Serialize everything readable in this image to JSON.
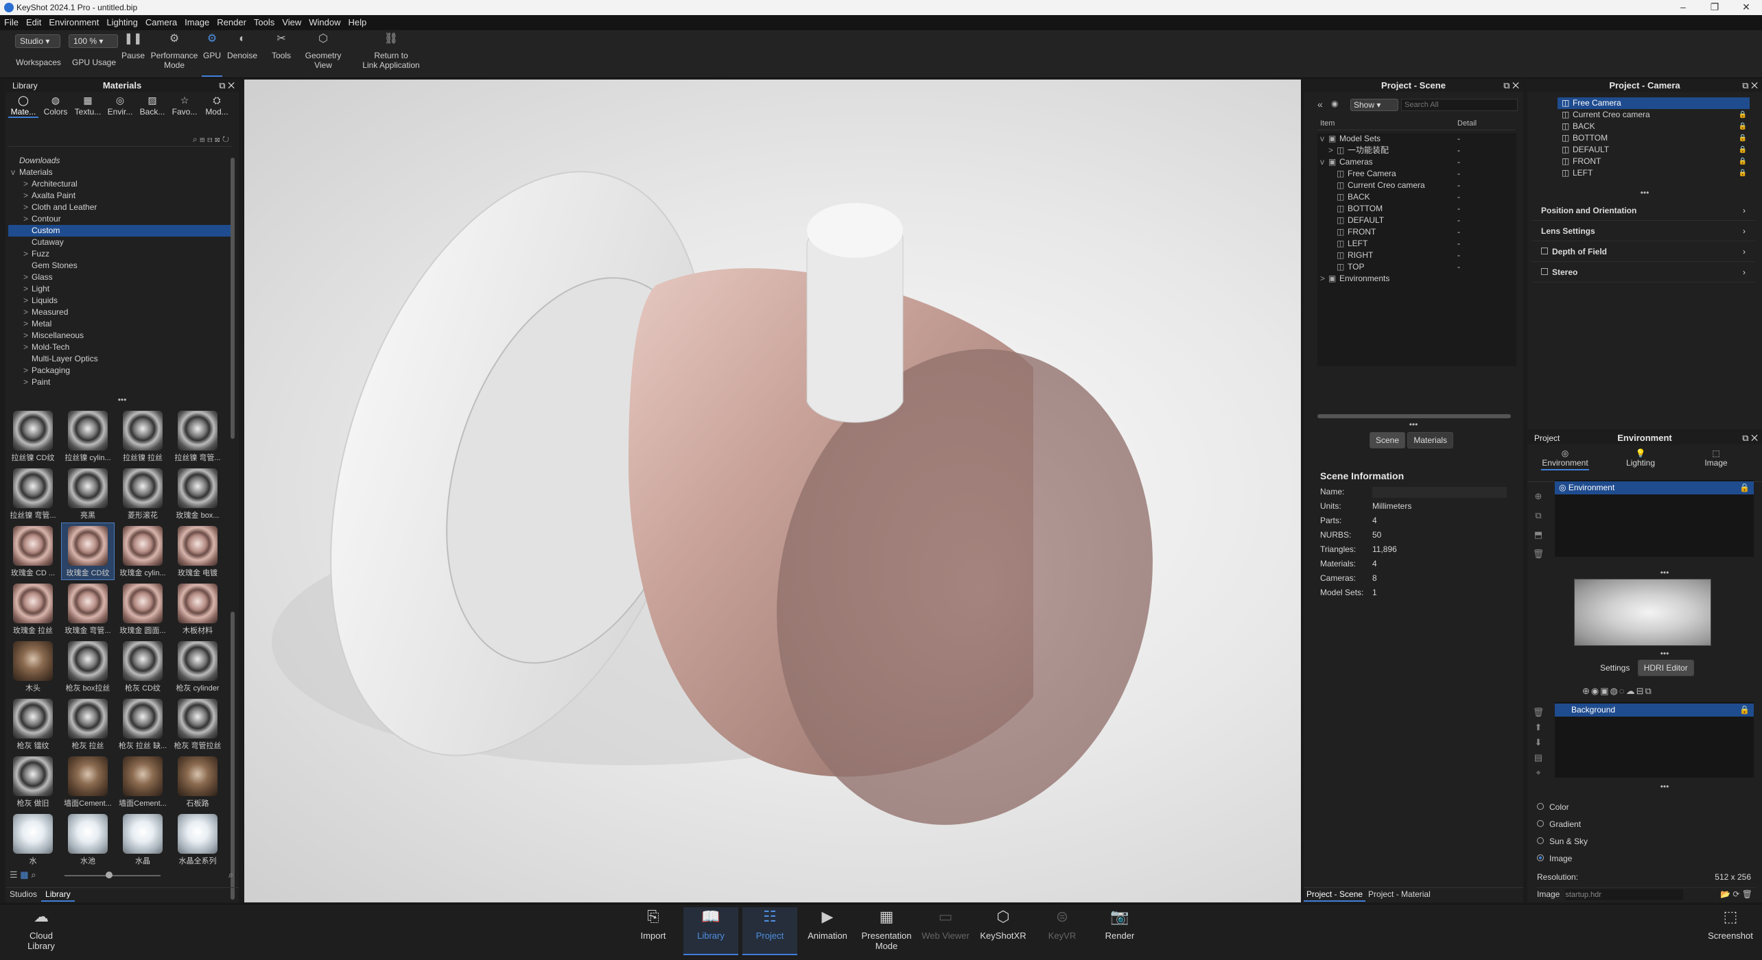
{
  "window": {
    "title": "KeyShot 2024.1 Pro  - untitled.bip"
  },
  "menu": [
    "File",
    "Edit",
    "Environment",
    "Lighting",
    "Camera",
    "Image",
    "Render",
    "Tools",
    "View",
    "Window",
    "Help"
  ],
  "toolbar": {
    "workspace_value": "Studio",
    "zoom_value": "100 %",
    "items": {
      "workspaces": "Workspaces",
      "gpu_usage": "GPU Usage",
      "pause": "Pause",
      "performance": "Performance\nMode",
      "gpu": "GPU",
      "denoise": "Denoise",
      "tools": "Tools",
      "geometry_view": "Geometry\nView",
      "return_link": "Return to\nLink Application"
    }
  },
  "library": {
    "label": "Library",
    "title": "Materials",
    "tabs": [
      "Mate...",
      "Colors",
      "Textu...",
      "Envir...",
      "Back...",
      "Favo...",
      "Mod..."
    ],
    "tree": [
      {
        "t": "Downloads",
        "lvl": 0,
        "i": 1
      },
      {
        "t": "Materials",
        "lvl": 0,
        "e": "v"
      },
      {
        "t": "Architectural",
        "lvl": 1,
        "e": ">"
      },
      {
        "t": "Axalta Paint",
        "lvl": 1,
        "e": ">"
      },
      {
        "t": "Cloth and Leather",
        "lvl": 1,
        "e": ">"
      },
      {
        "t": "Contour",
        "lvl": 1,
        "e": ">"
      },
      {
        "t": "Custom",
        "lvl": 1,
        "sel": 1
      },
      {
        "t": "Cutaway",
        "lvl": 1
      },
      {
        "t": "Fuzz",
        "lvl": 1,
        "e": ">"
      },
      {
        "t": "Gem Stones",
        "lvl": 1
      },
      {
        "t": "Glass",
        "lvl": 1,
        "e": ">"
      },
      {
        "t": "Light",
        "lvl": 1,
        "e": ">"
      },
      {
        "t": "Liquids",
        "lvl": 1,
        "e": ">"
      },
      {
        "t": "Measured",
        "lvl": 1,
        "e": ">"
      },
      {
        "t": "Metal",
        "lvl": 1,
        "e": ">"
      },
      {
        "t": "Miscellaneous",
        "lvl": 1,
        "e": ">"
      },
      {
        "t": "Mold-Tech",
        "lvl": 1,
        "e": ">"
      },
      {
        "t": "Multi-Layer Optics",
        "lvl": 1
      },
      {
        "t": "Packaging",
        "lvl": 1,
        "e": ">"
      },
      {
        "t": "Paint",
        "lvl": 1,
        "e": ">"
      }
    ],
    "thumbs": [
      "拉丝镍 CD纹",
      "拉丝镍 cylin...",
      "拉丝镍 拉丝",
      "拉丝镍 弯管...",
      "拉丝镍 弯管...",
      "亮黑",
      "菱形滚花",
      "玫瑰金 box...",
      "玫瑰金 CD ...",
      "玫瑰金 CD纹",
      "玫瑰金 cylin...",
      "玫瑰金 电镀",
      "玫瑰金 拉丝",
      "玫瑰金 弯管...",
      "玫瑰金 圆面...",
      "木板材料",
      "木头",
      "枪灰 box拉丝",
      "枪灰 CD纹",
      "枪灰 cylinder",
      "枪灰 镭纹",
      "枪灰 拉丝",
      "枪灰 拉丝 缺...",
      "枪灰 弯管拉丝",
      "枪灰 做旧",
      "墙面Cement...",
      "墙面Cement...",
      "石板路",
      "水",
      "水池",
      "水晶",
      "水晶全系列"
    ],
    "bottom_tabs": [
      "Studios",
      "Library"
    ]
  },
  "scene": {
    "title": "Project - Scene",
    "show": "Show",
    "search_placeholder": "Search All",
    "col_item": "Item",
    "col_detail": "Detail",
    "tree": [
      {
        "t": "Model Sets",
        "lvl": 0,
        "e": "v"
      },
      {
        "t": "一功能装配",
        "lvl": 1,
        "e": ">"
      },
      {
        "t": "Cameras",
        "lvl": 0,
        "e": "v"
      },
      {
        "t": "Free Camera",
        "lvl": 1
      },
      {
        "t": "Current Creo camera",
        "lvl": 1
      },
      {
        "t": "BACK",
        "lvl": 1
      },
      {
        "t": "BOTTOM",
        "lvl": 1
      },
      {
        "t": "DEFAULT",
        "lvl": 1
      },
      {
        "t": "FRONT",
        "lvl": 1
      },
      {
        "t": "LEFT",
        "lvl": 1
      },
      {
        "t": "RIGHT",
        "lvl": 1
      },
      {
        "t": "TOP",
        "lvl": 1
      },
      {
        "t": "Environments",
        "lvl": 0,
        "e": ">"
      }
    ],
    "dash": "-",
    "tab_scene": "Scene",
    "tab_materials": "Materials",
    "info_title": "Scene Information",
    "info": [
      [
        "Name:",
        ""
      ],
      [
        "Units:",
        "Millimeters"
      ],
      [
        "Parts:",
        "4"
      ],
      [
        "NURBS:",
        "50"
      ],
      [
        "Triangles:",
        "11,896"
      ],
      [
        "Materials:",
        "4"
      ],
      [
        "Cameras:",
        "8"
      ],
      [
        "Model Sets:",
        "1"
      ]
    ],
    "bottom_tabs": [
      "Project - Scene",
      "Project - Material"
    ]
  },
  "camera": {
    "title": "Project - Camera",
    "list": [
      "Free Camera",
      "Current Creo camera",
      "BACK",
      "BOTTOM",
      "DEFAULT",
      "FRONT",
      "LEFT"
    ],
    "sections": [
      "Position and Orientation",
      "Lens Settings",
      "Depth of Field",
      "Stereo"
    ]
  },
  "environment": {
    "label": "Project",
    "title": "Environment",
    "tabs": [
      "Environment",
      "Lighting",
      "Image"
    ],
    "list": [
      "Environment"
    ],
    "settings": "Settings",
    "hdri": "HDRI Editor",
    "bg_list": [
      "Background"
    ],
    "bg_options": [
      "Color",
      "Gradient",
      "Sun & Sky",
      "Image"
    ],
    "bg_selected": "Image",
    "resolution_label": "Resolution:",
    "resolution": "512 x 256",
    "image_label": "Image",
    "image_value": "startup.hdr"
  },
  "bottom": {
    "cloud": "Cloud\nLibrary",
    "import": "Import",
    "library": "Library",
    "project": "Project",
    "animation": "Animation",
    "presentation": "Presentation\nMode",
    "webviewer": "Web Viewer",
    "keyshotxr": "KeyShotXR",
    "keyvr": "KeyVR",
    "render": "Render",
    "screenshot": "Screenshot"
  },
  "colors": {
    "accent": "#3f7fdb",
    "selection": "#1f4c8f",
    "rose_gold": "#b99088"
  }
}
